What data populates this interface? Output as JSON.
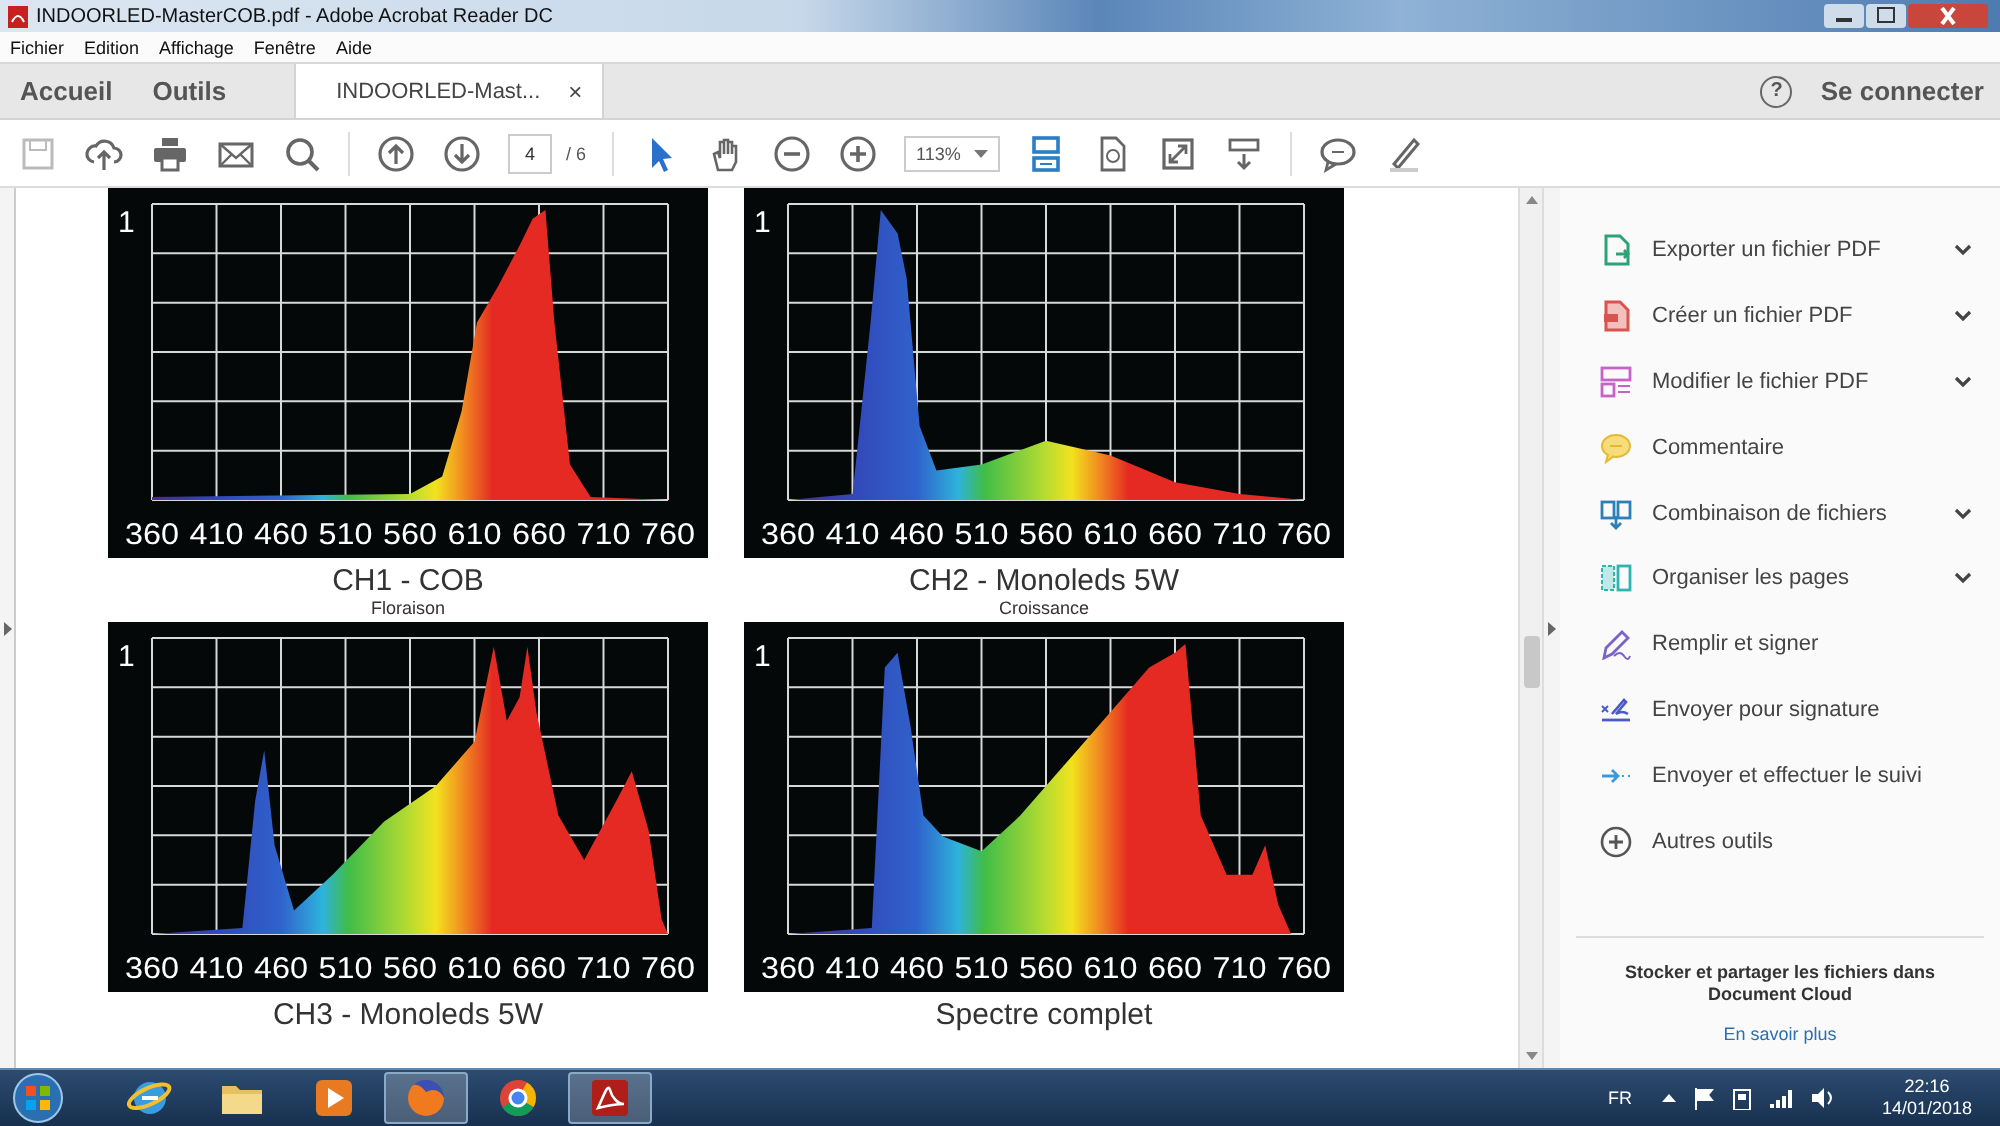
{
  "window": {
    "title": "INDOORLED-MasterCOB.pdf - Adobe Acrobat Reader DC"
  },
  "menu": [
    "Fichier",
    "Edition",
    "Affichage",
    "Fenêtre",
    "Aide"
  ],
  "tabs": [
    {
      "label": "Accueil",
      "selected": false
    },
    {
      "label": "Outils",
      "selected": false
    },
    {
      "label": "INDOORLED-Mast...",
      "selected": true,
      "close": "×"
    }
  ],
  "account": {
    "help": "?",
    "label": "Se connecter"
  },
  "toolbar": {
    "page": "4",
    "page_total": "/ 6",
    "zoom": "113%"
  },
  "document": {
    "charts": [
      {
        "kind": "cob",
        "y_label": "1",
        "x_labels": [
          "360",
          "410",
          "460",
          "510",
          "560",
          "610",
          "660",
          "710",
          "760"
        ],
        "title": "CH1 - COB",
        "subtitle": "Floraison"
      },
      {
        "kind": "growth",
        "y_label": "1",
        "x_labels": [
          "360",
          "410",
          "460",
          "510",
          "560",
          "610",
          "660",
          "710",
          "760"
        ],
        "title": "CH2 - Monoleds 5W",
        "subtitle": "Croissance"
      },
      {
        "kind": "mix",
        "y_label": "1",
        "x_labels": [
          "360",
          "410",
          "460",
          "510",
          "560",
          "610",
          "660",
          "710",
          "760"
        ],
        "title": "CH3 - Monoleds 5W"
      },
      {
        "kind": "full",
        "y_label": "1",
        "x_labels": [
          "360",
          "410",
          "460",
          "510",
          "560",
          "610",
          "660",
          "710",
          "760"
        ],
        "title": "Spectre complet"
      }
    ]
  },
  "tools_pane": {
    "items": [
      {
        "label": "Exporter un fichier PDF",
        "expandable": true
      },
      {
        "label": "Créer un fichier PDF",
        "expandable": true
      },
      {
        "label": "Modifier le fichier PDF",
        "expandable": true
      },
      {
        "label": "Commentaire",
        "expandable": false
      },
      {
        "label": "Combinaison de fichiers",
        "expandable": true
      },
      {
        "label": "Organiser les pages",
        "expandable": true
      },
      {
        "label": "Remplir et signer",
        "expandable": false
      },
      {
        "label": "Envoyer pour signature",
        "expandable": false
      },
      {
        "label": "Envoyer et effectuer le suivi",
        "expandable": false
      },
      {
        "label": "Autres outils",
        "expandable": false
      }
    ],
    "cloud_text": "Stocker et partager les fichiers dans Document Cloud",
    "cloud_link": "En savoir plus"
  },
  "taskbar": {
    "apps": [
      {
        "running": false
      },
      {
        "running": false
      },
      {
        "running": false
      },
      {
        "running": true
      },
      {
        "running": false
      },
      {
        "running": true
      }
    ]
  },
  "tray": {
    "language": "FR",
    "time": "22:16",
    "date": "14/01/2018"
  }
}
